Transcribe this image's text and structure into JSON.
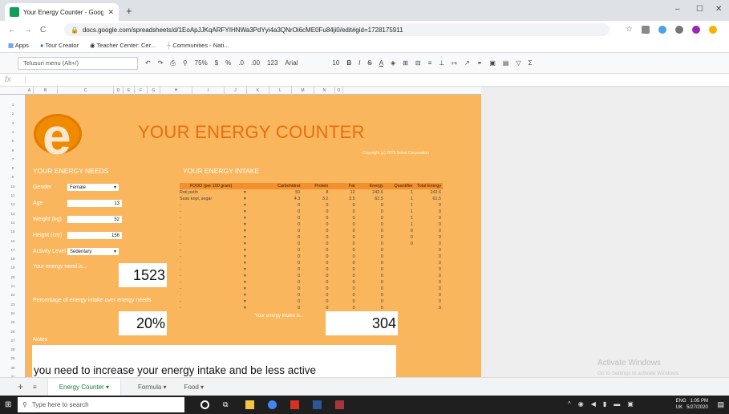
{
  "browser": {
    "tab_title": "Your Energy Counter - Google Ş",
    "url": "docs.google.com/spreadsheets/d/1EoApJJKqARFYIHNWa3PdYyi4a3QNrOi6cME0Fu84ji0/edit#gid=1728175911",
    "bookmarks": [
      "Apps",
      "Tour Creator",
      "Teacher Center: Cer...",
      "Communities - Nati..."
    ]
  },
  "toolbar": {
    "menu_search": "Telusuri menu (Alt+/)",
    "zoom": "75%",
    "currency": "$",
    "percent": "%",
    "dec_less": ".0",
    "dec_more": ".00",
    "format_more": "123",
    "font": "Arial",
    "font_size": "10",
    "bold": "B",
    "italic": "I",
    "strike": "S",
    "text_color": "A"
  },
  "formula_bar": {
    "label": "fx"
  },
  "columns": [
    "A",
    "B",
    "C",
    "D",
    "E",
    "F",
    "G",
    "H",
    "I",
    "J",
    "K",
    "L",
    "M",
    "N",
    "O"
  ],
  "rows": [
    "1",
    "2",
    "3",
    "4",
    "5",
    "6",
    "7",
    "8",
    "9",
    "10",
    "11",
    "12",
    "13",
    "14",
    "15",
    "16",
    "17",
    "18",
    "19",
    "20",
    "21",
    "22",
    "23",
    "24",
    "25",
    "26",
    "27",
    "28",
    "29",
    "30",
    "31"
  ],
  "sheet": {
    "title": "YOUR ENERGY COUNTER",
    "copyright": "Copyright (c) 2019 Sobat Corporation",
    "needs": {
      "heading": "YOUR ENERGY NEEDS",
      "gender_label": "Gender",
      "gender_value": "Female",
      "age_label": "Age",
      "age_value": "13",
      "weight_label": "Weight (kg)",
      "weight_value": "52",
      "height_label": "Height (cm)",
      "height_value": "156",
      "activity_label": "Activity Level",
      "activity_value": "Sedentary",
      "need_label": "Your energy need is...",
      "need_value": "1523",
      "pct_label": "Percentage of energy intake over energy needs",
      "pct_value": "20%"
    },
    "intake": {
      "heading": "YOUR ENERGY INTAKE",
      "headers": [
        "FOOD (per 100 gram)",
        "",
        "Carbohidrat",
        "Protein",
        "Fat",
        "Energy",
        "Quantifier",
        "Total Energy"
      ],
      "rows": [
        [
          "Roti putih",
          "▾",
          "50",
          "8",
          "12",
          "242.6",
          "1",
          "242.6"
        ],
        [
          "Susu kopi, segar",
          "▾",
          "4.3",
          "3.2",
          "3.5",
          "61.5",
          "1",
          "61.5"
        ],
        [
          "-",
          "▾",
          "0",
          "0",
          "0",
          "0",
          "1",
          "0"
        ],
        [
          "-",
          "▾",
          "0",
          "0",
          "0",
          "0",
          "1",
          "0"
        ],
        [
          "-",
          "▾",
          "0",
          "0",
          "0",
          "0",
          "1",
          "0"
        ],
        [
          "-",
          "▾",
          "0",
          "0",
          "0",
          "0",
          "1",
          "0"
        ],
        [
          "-",
          "▾",
          "0",
          "0",
          "0",
          "0",
          "0",
          "0"
        ],
        [
          "-",
          "▾",
          "0",
          "0",
          "0",
          "0",
          "0",
          "0"
        ],
        [
          "-",
          "▾",
          "0",
          "0",
          "0",
          "0",
          "0",
          "0"
        ],
        [
          "-",
          "▾",
          "0",
          "0",
          "0",
          "0",
          "",
          "0"
        ],
        [
          "-",
          "▾",
          "0",
          "0",
          "0",
          "0",
          "",
          "0"
        ],
        [
          "-",
          "▾",
          "0",
          "0",
          "0",
          "0",
          "",
          "0"
        ],
        [
          "-",
          "▾",
          "0",
          "0",
          "0",
          "0",
          "",
          "0"
        ],
        [
          "-",
          "▾",
          "0",
          "0",
          "0",
          "0",
          "",
          "0"
        ],
        [
          "-",
          "▾",
          "0",
          "0",
          "0",
          "0",
          "",
          "0"
        ],
        [
          "-",
          "▾",
          "0",
          "0",
          "0",
          "0",
          "",
          "0"
        ],
        [
          "-",
          "▾",
          "0",
          "0",
          "0",
          "0",
          "",
          "0"
        ],
        [
          "-",
          "▾",
          "0",
          "0",
          "0",
          "0",
          "",
          "0"
        ],
        [
          "-",
          "▾",
          "0",
          "0",
          "0",
          "0",
          "",
          "0"
        ]
      ],
      "intake_label": "Your energy intake is...",
      "intake_value": "304"
    },
    "notes_label": "Notes",
    "notes_text": "you need to increase your energy intake and be less active"
  },
  "sheet_tabs": [
    "Energy Counter",
    "Formula",
    "Food"
  ],
  "windows": {
    "activate_title": "Activate Windows",
    "activate_sub": "Go to Settings to activate Windows.",
    "search_placeholder": "Type here to search",
    "lang": "ENG",
    "region": "UK",
    "time": "1:05 PM",
    "date": "5/27/2020"
  },
  "colors": {
    "sheet_bg": "#fab65c",
    "title": "#e66e10",
    "header_bar": "#f28f2e",
    "sheets_green": "#0f9d58"
  }
}
